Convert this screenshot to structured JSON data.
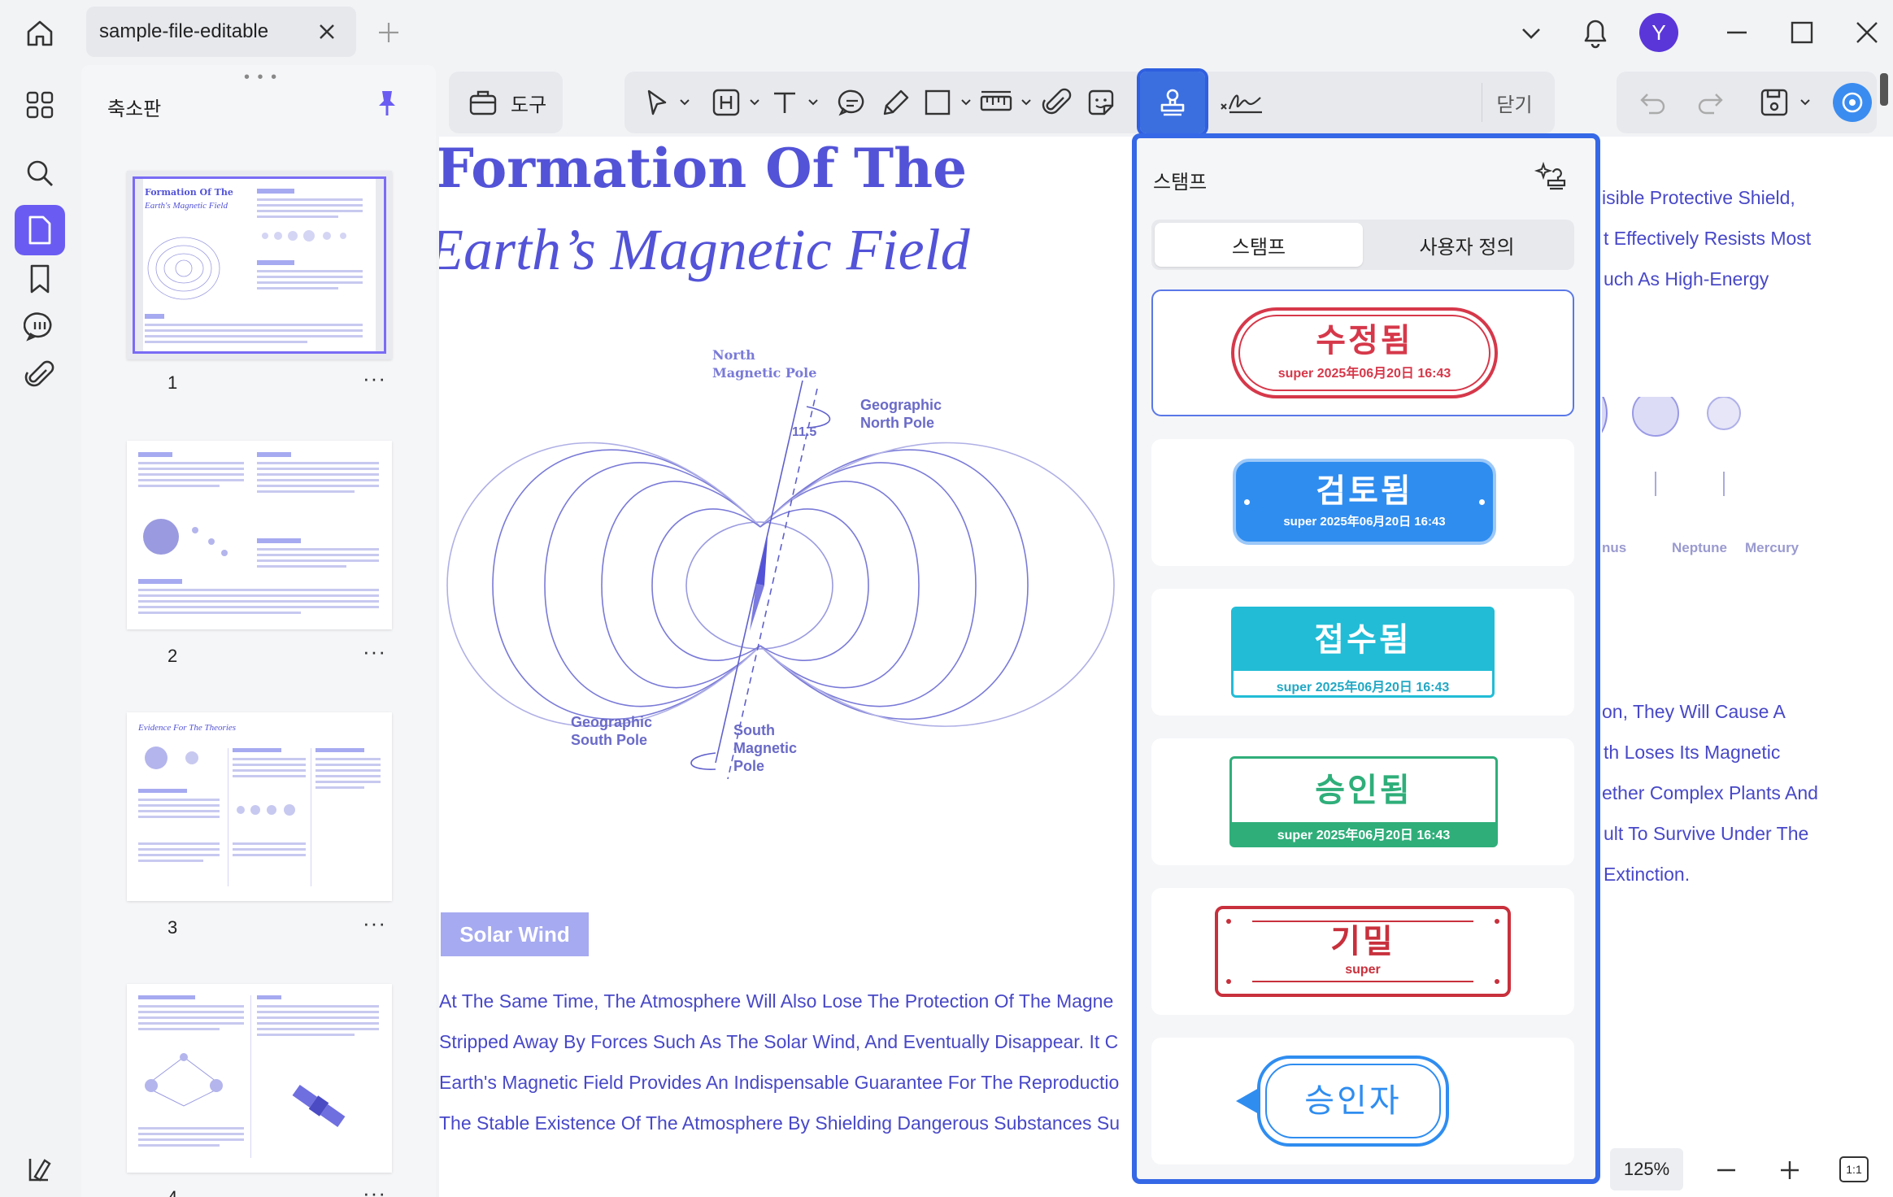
{
  "tab": {
    "title": "sample-file-editable"
  },
  "avatar": {
    "initial": "Y"
  },
  "thumbnails": {
    "title": "축소판",
    "pages": [
      {
        "num": "1",
        "title": "Formation Of The",
        "subtitle": "Earth's Magnetic Field"
      },
      {
        "num": "2"
      },
      {
        "num": "3",
        "title": "Evidence For The Theories"
      },
      {
        "num": "4"
      }
    ],
    "more": "···"
  },
  "toolbar": {
    "tools_button": "도구",
    "close_label": "닫기"
  },
  "document": {
    "title_line1": "Formation Of The",
    "title_line2": "Earth’s Magnetic Field",
    "diagram": {
      "north_magnetic": [
        "North",
        "Magnetic Pole"
      ],
      "geographic_north": [
        "Geographic",
        "North Pole"
      ],
      "angle": "11.5",
      "geographic_south": [
        "Geographic",
        "South Pole"
      ],
      "south_magnetic": [
        "South",
        "Magnetic",
        "Pole"
      ]
    },
    "section_badge": "Solar Wind",
    "body_lines": [
      "At The Same Time, The Atmosphere Will Also Lose The Protection Of The Magne",
      "Stripped Away By Forces Such As The Solar Wind, And Eventually Disappear. It C",
      "Earth's Magnetic Field Provides An Indispensable Guarantee For The Reproductio",
      "The Stable Existence Of The Atmosphere By Shielding Dangerous Substances Su"
    ],
    "right_lines_top": [
      "isible Protective Shield,",
      "t Effectively Resists Most",
      "uch As High-Energy"
    ],
    "right_lines_bottom": [
      "on, They Will Cause A",
      "th Loses Its Magnetic",
      "ether Complex Plants And",
      "ult To Survive Under The",
      "Extinction."
    ],
    "planets": [
      "nus",
      "Neptune",
      "Mercury"
    ]
  },
  "stamp_panel": {
    "title": "스탬프",
    "segments": [
      "스탬프",
      "사용자 정의"
    ],
    "stamps": [
      {
        "main": "수정됨",
        "sub": "super 2025年06月20日 16:43",
        "color": "#d6384a"
      },
      {
        "main": "검토됨",
        "sub": "super 2025年06月20日 16:43",
        "color": "#2f8df0"
      },
      {
        "main": "접수됨",
        "sub": "super 2025年06月20日 16:43",
        "color": "#22bcd6"
      },
      {
        "main": "승인됨",
        "sub": "super 2025年06月20日 16:43",
        "color": "#2fae7a"
      },
      {
        "main": "기밀",
        "sub": "super",
        "color": "#c8303c"
      },
      {
        "main": "승인자",
        "sub": "",
        "color": "#2f8df0"
      }
    ]
  },
  "zoom": {
    "value": "125%",
    "fit_label": "1:1"
  }
}
